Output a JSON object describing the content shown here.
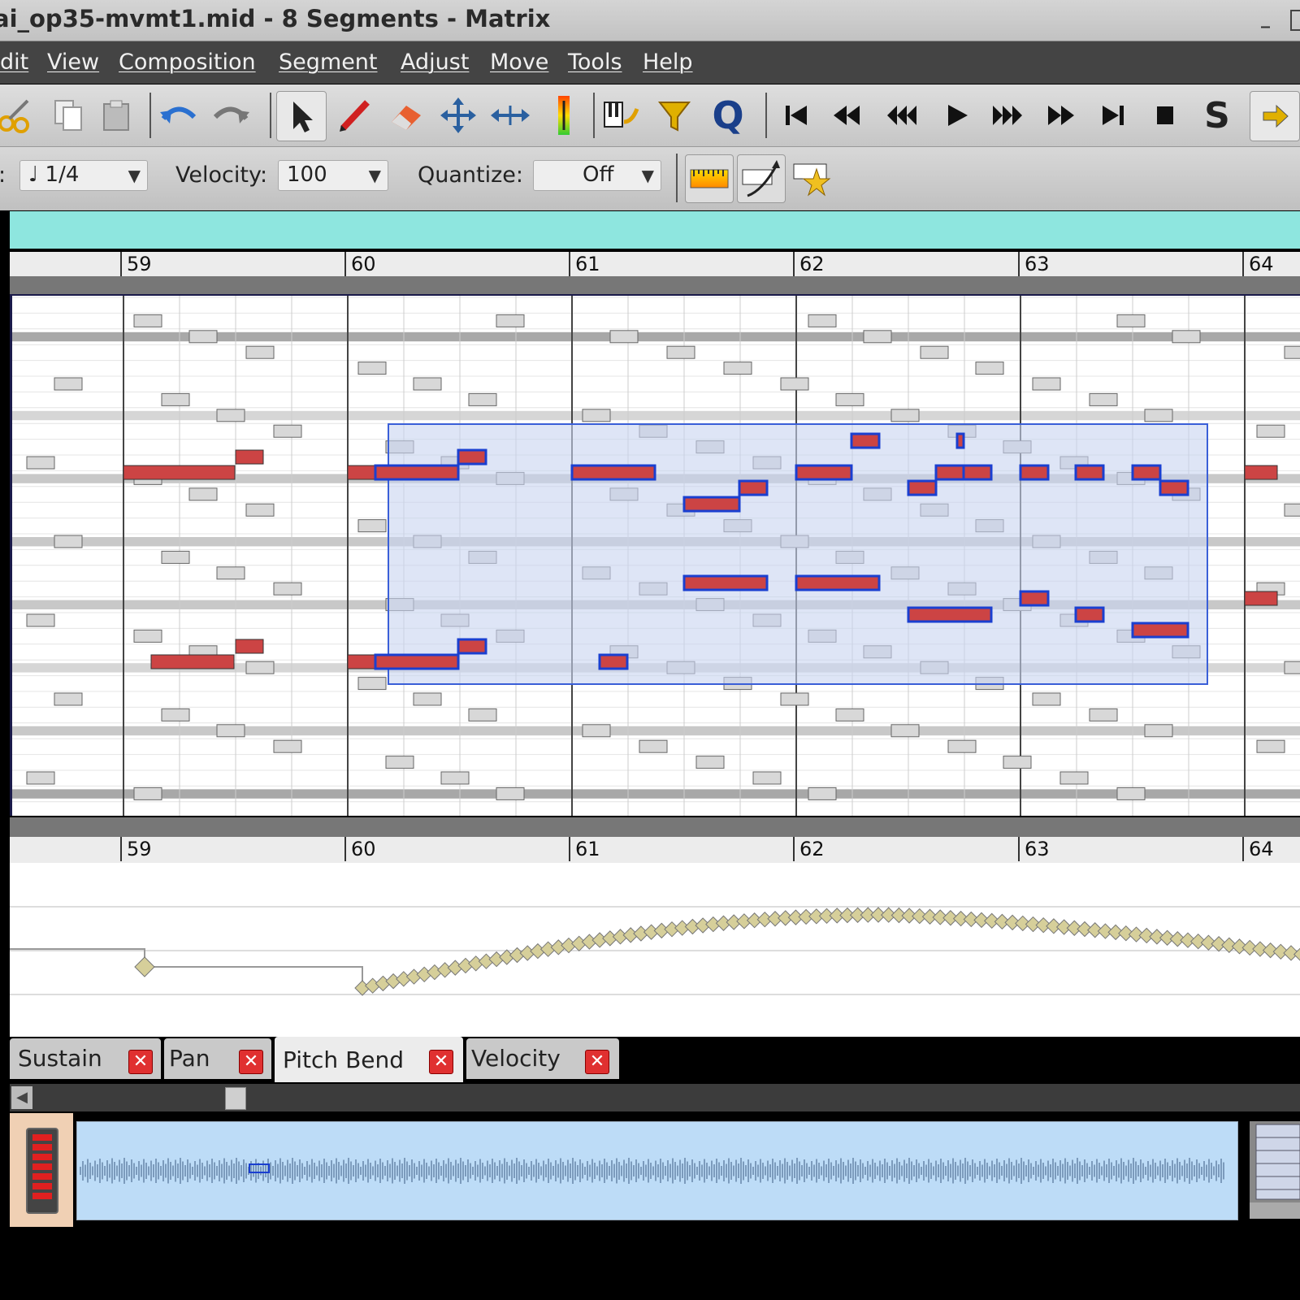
{
  "window": {
    "title": "ai_op35-mvmt1.mid - 8 Segments - Matrix"
  },
  "menus": [
    "dit",
    "View",
    "Composition",
    "Segment",
    "Adjust",
    "Move",
    "Tools",
    "Help"
  ],
  "toolbar": {
    "icons": [
      "cut-icon",
      "copy-icon",
      "paste-icon",
      "undo-icon",
      "redo-icon",
      "select-tool-icon",
      "draw-tool-icon",
      "erase-tool-icon",
      "move-tool-icon",
      "resize-tool-icon",
      "velocity-tool-icon",
      "step-recording-icon",
      "filter-icon",
      "quantize-icon",
      "rewind-to-start-icon",
      "rewind-icon",
      "fast-rewind-icon",
      "play-icon",
      "fast-forward-icon",
      "forward-icon",
      "forward-to-end-icon",
      "stop-icon",
      "solo-icon",
      "next-icon"
    ],
    "quantize_glyph": "Q",
    "solo_glyph": "S"
  },
  "toolbar2": {
    "note_label": ":",
    "note_value": "1/4",
    "velocity_label": "Velocity:",
    "velocity_value": "100",
    "quantize_label": "Quantize:",
    "quantize_value": "Off"
  },
  "ruler": {
    "bars": [
      "59",
      "60",
      "61",
      "62",
      "63",
      "64"
    ]
  },
  "control_tabs": [
    {
      "label": "Sustain",
      "active": false
    },
    {
      "label": "Pan",
      "active": false
    },
    {
      "label": "Pitch Bend",
      "active": true
    },
    {
      "label": "Velocity",
      "active": false
    }
  ],
  "colors": {
    "selected_note": "#cc4444",
    "selected_note_border": "#1a3fd0",
    "selection_fill": "#c8d4f0",
    "other_note": "#d8d8d8",
    "pitch_bend_marker": "#d6cf9a",
    "timeline": "#8ee6df"
  }
}
